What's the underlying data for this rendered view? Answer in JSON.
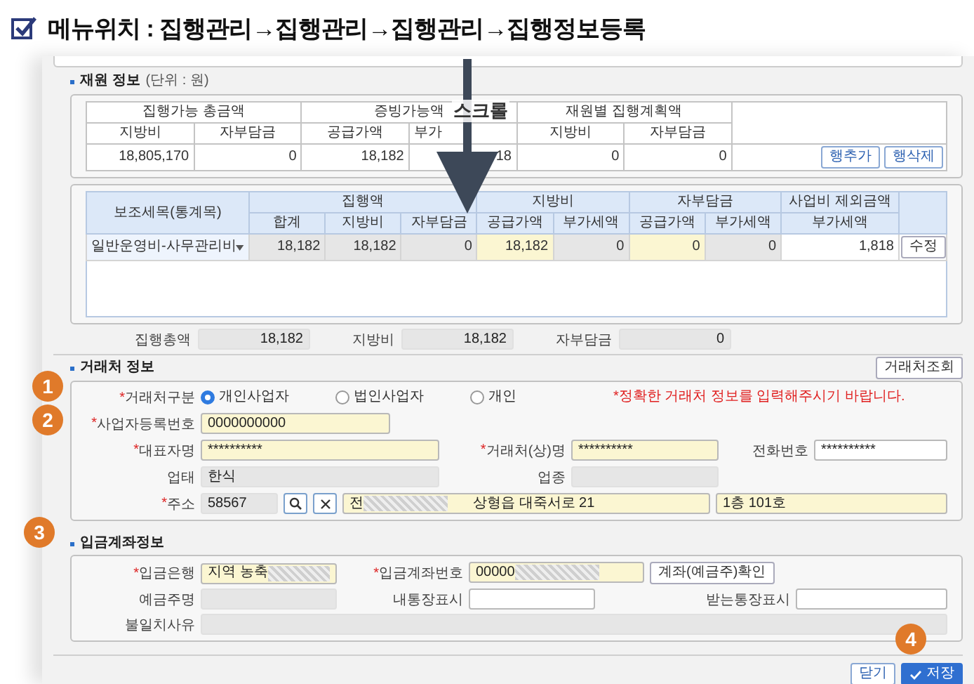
{
  "menu": {
    "checked": true,
    "title": "메뉴위치 : 집행관리→집행관리→집행관리→집행정보등록"
  },
  "funding": {
    "title": "재원 정보",
    "unit": "(단위 : 원)",
    "summary": {
      "groups": [
        {
          "label": "집행가능 총금액",
          "columns": [
            "지방비",
            "자부담금"
          ]
        },
        {
          "label": "증빙가능액",
          "columns": [
            "공급가액",
            "부가"
          ]
        },
        {
          "label": "재원별 집행계획액",
          "columns": [
            "지방비",
            "자부담금"
          ]
        }
      ],
      "values": [
        "18,805,170",
        "0",
        "18,182",
        "18",
        "0",
        "0"
      ],
      "buttons": [
        "행추가",
        "행삭제"
      ]
    },
    "detail": {
      "first_column": "보조세목(통계목)",
      "groups": [
        {
          "label": "집행액",
          "columns": [
            "합계",
            "지방비",
            "자부담금"
          ]
        },
        {
          "label": "지방비",
          "columns": [
            "공급가액",
            "부가세액"
          ]
        },
        {
          "label": "자부담금",
          "columns": [
            "공급가액",
            "부가세액"
          ]
        },
        {
          "label": "사업비 제외금액",
          "columns": [
            "부가세액"
          ]
        }
      ],
      "rows": [
        {
          "item": "일반운영비-사무관리비",
          "button": "수정",
          "cells": [
            {
              "value": "18,182",
              "kind": "readonly"
            },
            {
              "value": "18,182",
              "kind": "readonly"
            },
            {
              "value": "0",
              "kind": "readonly"
            },
            {
              "value": "18,182",
              "kind": "input"
            },
            {
              "value": "0",
              "kind": "readonly"
            },
            {
              "value": "0",
              "kind": "input"
            },
            {
              "value": "0",
              "kind": "readonly"
            },
            {
              "value": "1,818",
              "kind": "plain"
            }
          ]
        }
      ]
    },
    "totals": [
      {
        "label": "집행총액",
        "value": "18,182"
      },
      {
        "label": "지방비",
        "value": "18,182"
      },
      {
        "label": "자부담금",
        "value": "0"
      }
    ]
  },
  "vendor": {
    "title": "거래처 정보",
    "lookup_button": "거래처조회",
    "type": {
      "mark": "*",
      "label": "거래처구분",
      "options": [
        {
          "label": "개인사업자",
          "selected": true
        },
        {
          "label": "법인사업자",
          "selected": false
        },
        {
          "label": "개인",
          "selected": false
        }
      ],
      "notice": "*정확한 거래처 정보를 입력해주시기 바랍니다."
    },
    "business_no": {
      "mark": "*",
      "label": "사업자등록번호",
      "value": "0000000000",
      "kind": "input"
    },
    "representative": {
      "mark": "*",
      "label": "대표자명",
      "value": "**********",
      "kind": "input"
    },
    "name": {
      "mark": "*",
      "label": "거래처(상)명",
      "value": "**********",
      "kind": "input"
    },
    "phone": {
      "label": "전화번호",
      "value": "**********",
      "kind": "plain"
    },
    "business_type": {
      "label": "업태",
      "value": "한식",
      "kind": "readonly"
    },
    "business_item": {
      "label": "업종",
      "kind": "readonly"
    },
    "address": {
      "mark": "*",
      "label": "주소",
      "zip": "58567",
      "street_start": "전",
      "street_rest": "상형읍 대죽서로 21",
      "detail": "1층 101호"
    }
  },
  "account": {
    "title": "입금계좌정보",
    "bank": {
      "mark": "*",
      "label": "입금은행",
      "value": "지역 농축",
      "kind": "input"
    },
    "account_no": {
      "mark": "*",
      "label": "입금계좌번호",
      "value": "00000",
      "kind": "input"
    },
    "verify_button": "계좌(예금주)확인",
    "holder": {
      "label": "예금주명",
      "kind": "readonly"
    },
    "my_memo": {
      "label": "내통장표시",
      "kind": "plain"
    },
    "their_memo": {
      "label": "받는통장표시",
      "kind": "plain"
    },
    "mismatch": {
      "label": "불일치사유",
      "kind": "readonly"
    }
  },
  "footer": {
    "buttons": [
      {
        "label": "닫기",
        "kind": "default"
      },
      {
        "label": "저장",
        "kind": "primary"
      }
    ]
  },
  "overlay": {
    "scroll_label": "스크롤",
    "steps": [
      "1",
      "2",
      "3",
      "4"
    ]
  }
}
